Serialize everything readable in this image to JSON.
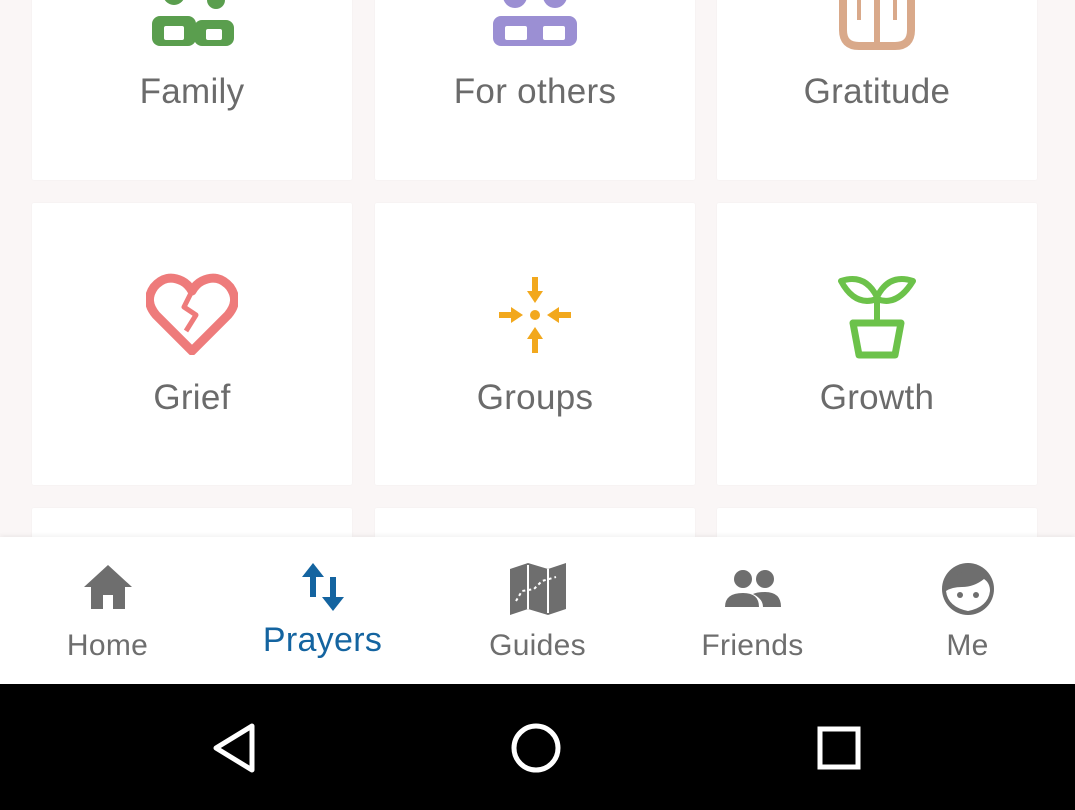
{
  "categories": [
    {
      "label": "Family",
      "icon": "family-icon",
      "color": "#5a9e4e"
    },
    {
      "label": "For others",
      "icon": "for-others-icon",
      "color": "#9b8fd3"
    },
    {
      "label": "Gratitude",
      "icon": "gratitude-icon",
      "color": "#d9a98a"
    },
    {
      "label": "Grief",
      "icon": "broken-heart-icon",
      "color": "#ee7b7b"
    },
    {
      "label": "Groups",
      "icon": "groups-icon",
      "color": "#f2a81d"
    },
    {
      "label": "Growth",
      "icon": "plant-icon",
      "color": "#6cc24a"
    }
  ],
  "nav": {
    "active": "Prayers",
    "active_color": "#1464a0",
    "items": [
      {
        "label": "Home",
        "icon": "home-icon"
      },
      {
        "label": "Prayers",
        "icon": "prayers-arrows-icon"
      },
      {
        "label": "Guides",
        "icon": "map-icon"
      },
      {
        "label": "Friends",
        "icon": "friends-icon"
      },
      {
        "label": "Me",
        "icon": "face-icon"
      }
    ]
  },
  "system_nav": {
    "buttons": [
      "back-icon",
      "home-circle-icon",
      "recents-icon"
    ]
  }
}
